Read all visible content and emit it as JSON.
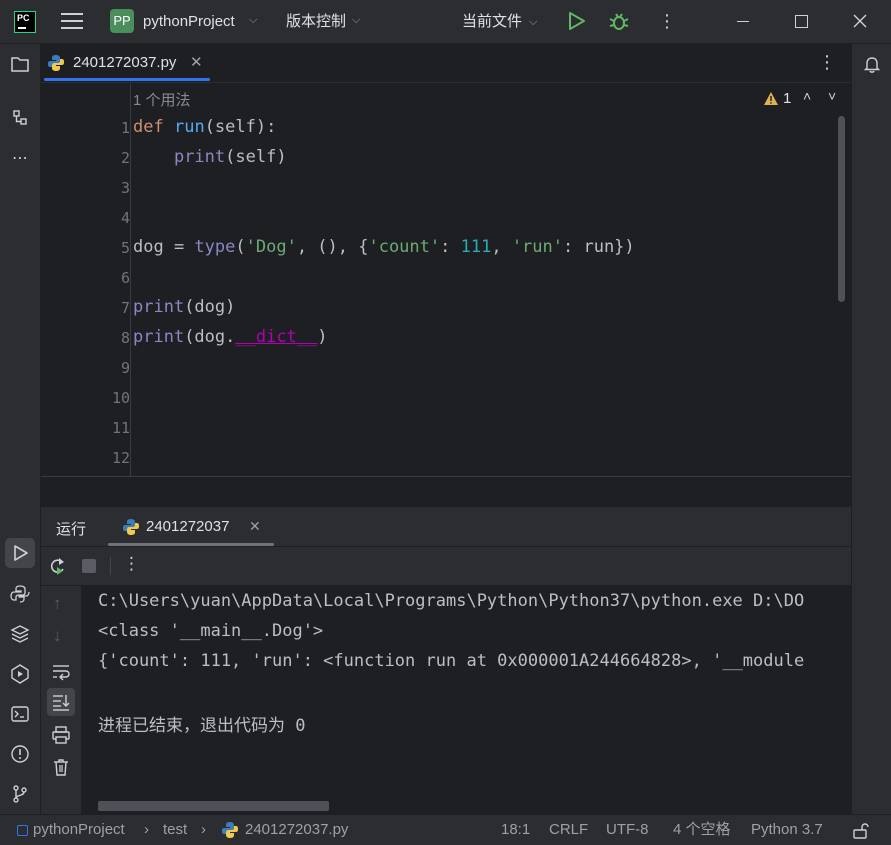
{
  "titlebar": {
    "app_logo": "PC",
    "project_badge": "PP",
    "project_name": "pythonProject",
    "vcs_label": "版本控制",
    "run_config": "当前文件",
    "colors": {
      "badge": "#4b8e5e",
      "run": "#5fb865",
      "debug": "#5fb865"
    }
  },
  "editor": {
    "tab_label": "2401272037.py",
    "usage_hint": "1 个用法",
    "warning_count": "1",
    "line_numbers": [
      "1",
      "2",
      "3",
      "4",
      "5",
      "6",
      "7",
      "8",
      "9",
      "10",
      "11",
      "12"
    ]
  },
  "run_panel": {
    "title": "运行",
    "tab_label": "2401272037",
    "console_lines": [
      "C:\\Users\\yuan\\AppData\\Local\\Programs\\Python\\Python37\\python.exe D:\\DO",
      "<class '__main__.Dog'>",
      "{'count': 111, 'run': <function run at 0x000001A244664828>, '__module",
      "",
      "进程已结束，退出代码为 0"
    ]
  },
  "statusbar": {
    "breadcrumb_project": "pythonProject",
    "breadcrumb_folder": "test",
    "breadcrumb_file": "2401272037.py",
    "position": "18:1",
    "line_ending": "CRLF",
    "encoding": "UTF-8",
    "indent": "4 个空格",
    "interpreter": "Python 3.7"
  }
}
